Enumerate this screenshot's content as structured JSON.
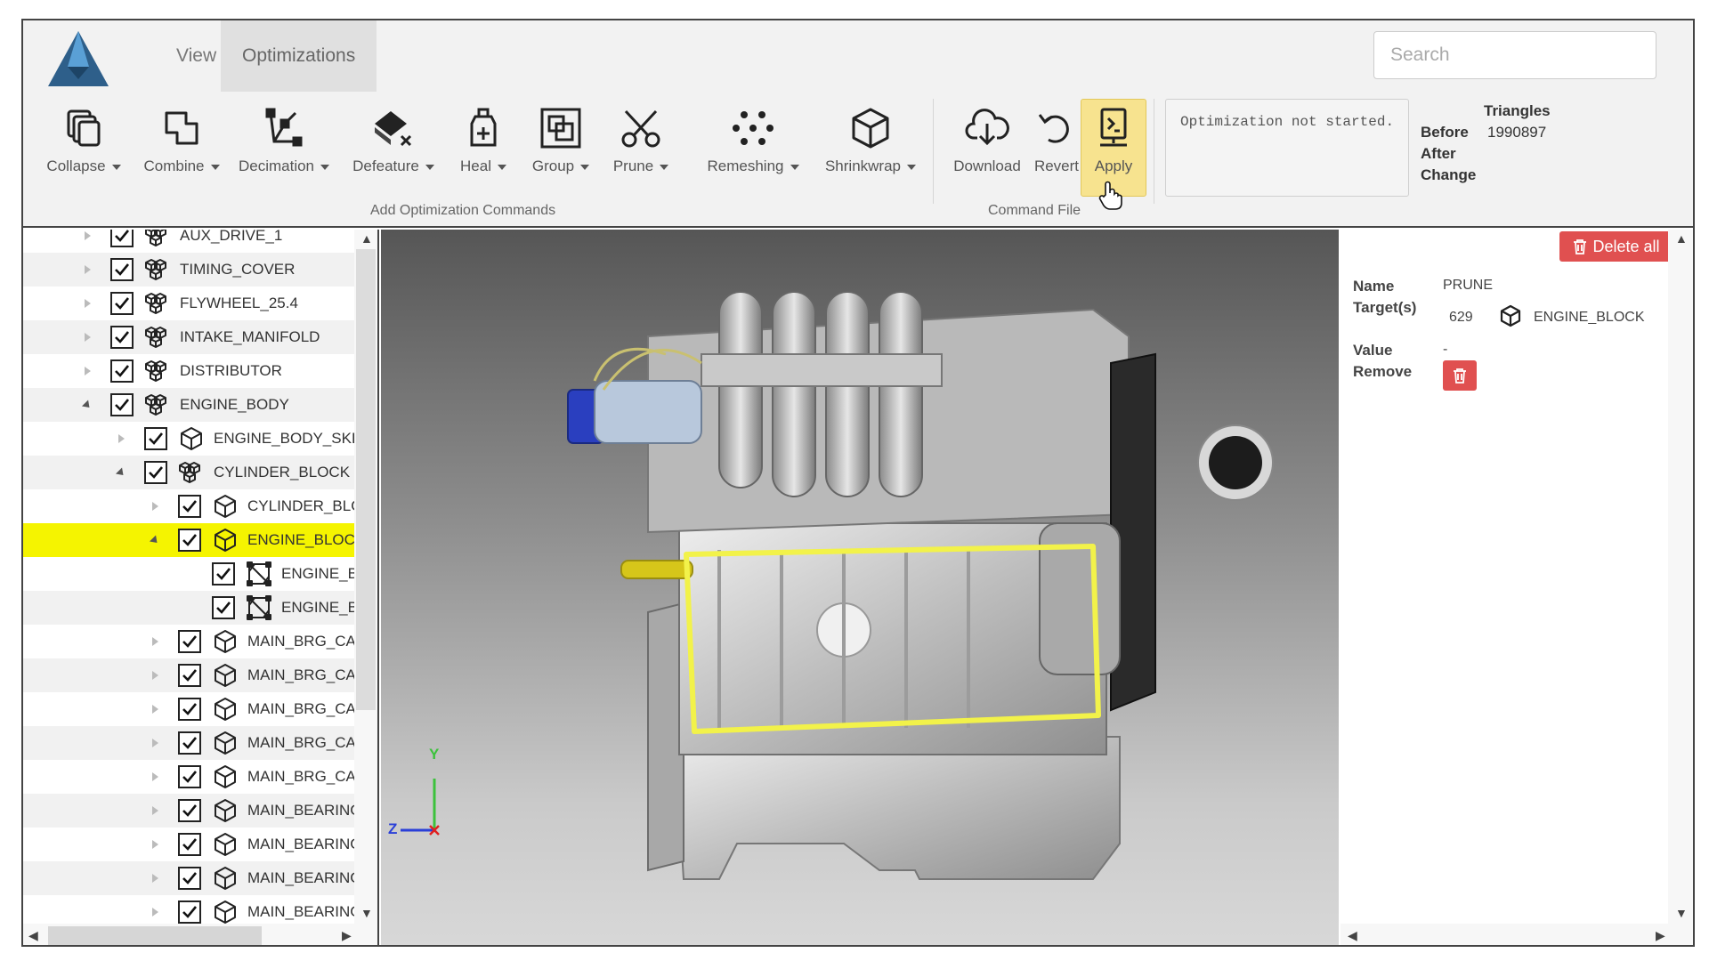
{
  "ribbon": {
    "tabs": [
      {
        "label": "View"
      },
      {
        "label": "Optimizations",
        "active": true
      }
    ],
    "search_placeholder": "Search",
    "tools": [
      {
        "label": "Collapse",
        "icon": "collapse-icon",
        "dropdown": true
      },
      {
        "label": "Combine",
        "icon": "combine-icon",
        "dropdown": true
      },
      {
        "label": "Decimation",
        "icon": "decimation-icon",
        "dropdown": true
      },
      {
        "label": "Defeature",
        "icon": "defeature-icon",
        "dropdown": true
      },
      {
        "label": "Heal",
        "icon": "heal-icon",
        "dropdown": true
      },
      {
        "label": "Group",
        "icon": "group-icon",
        "dropdown": true
      },
      {
        "label": "Prune",
        "icon": "scissors-icon",
        "dropdown": true
      },
      {
        "label": "Remeshing",
        "icon": "remeshing-icon",
        "dropdown": true
      },
      {
        "label": "Shrinkwrap",
        "icon": "shrinkwrap-icon",
        "dropdown": true
      }
    ],
    "add_group_label": "Add Optimization Commands",
    "file_tools": [
      {
        "label": "Download",
        "icon": "download-icon"
      },
      {
        "label": "Revert",
        "icon": "revert-icon"
      },
      {
        "label": "Apply",
        "icon": "apply-icon",
        "highlighted": true
      }
    ],
    "file_group_label": "Command File",
    "status": "Optimization not started.",
    "triangles": {
      "title": "Triangles",
      "before_label": "Before",
      "before_value": "1990897",
      "after_label": "After",
      "change_label": "Change"
    }
  },
  "tree": {
    "rows": [
      {
        "label": "AUX_DRIVE_1",
        "depth": 0,
        "expander": "collapsed",
        "icon": "assembly-icon"
      },
      {
        "label": "TIMING_COVER",
        "depth": 0,
        "expander": "collapsed",
        "icon": "assembly-icon"
      },
      {
        "label": "FLYWHEEL_25.4",
        "depth": 0,
        "expander": "collapsed",
        "icon": "assembly-icon"
      },
      {
        "label": "INTAKE_MANIFOLD",
        "depth": 0,
        "expander": "collapsed",
        "icon": "assembly-icon"
      },
      {
        "label": "DISTRIBUTOR",
        "depth": 0,
        "expander": "collapsed",
        "icon": "assembly-icon"
      },
      {
        "label": "ENGINE_BODY",
        "depth": 0,
        "expander": "expanded",
        "icon": "assembly-icon"
      },
      {
        "label": "ENGINE_BODY_SKEL",
        "depth": 1,
        "expander": "collapsed",
        "icon": "part-icon"
      },
      {
        "label": "CYLINDER_BLOCK",
        "depth": 1,
        "expander": "expanded",
        "icon": "assembly-icon"
      },
      {
        "label": "CYLINDER_BLOCI",
        "depth": 2,
        "expander": "collapsed",
        "icon": "part-icon"
      },
      {
        "label": "ENGINE_BLOCK",
        "depth": 2,
        "expander": "expanded",
        "icon": "part-icon",
        "selected": true
      },
      {
        "label": "ENGINE_BLO",
        "depth": 3,
        "expander": "none",
        "icon": "mesh-icon"
      },
      {
        "label": "ENGINE_BLO",
        "depth": 3,
        "expander": "none",
        "icon": "mesh-icon"
      },
      {
        "label": "MAIN_BRG_CAP_",
        "depth": 2,
        "expander": "collapsed",
        "icon": "part-icon"
      },
      {
        "label": "MAIN_BRG_CAP",
        "depth": 2,
        "expander": "collapsed",
        "icon": "part-icon"
      },
      {
        "label": "MAIN_BRG_CAP",
        "depth": 2,
        "expander": "collapsed",
        "icon": "part-icon"
      },
      {
        "label": "MAIN_BRG_CAP",
        "depth": 2,
        "expander": "collapsed",
        "icon": "part-icon"
      },
      {
        "label": "MAIN_BRG_CAP_",
        "depth": 2,
        "expander": "collapsed",
        "icon": "part-icon"
      },
      {
        "label": "MAIN_BEARING_E",
        "depth": 2,
        "expander": "collapsed",
        "icon": "part-icon"
      },
      {
        "label": "MAIN_BEARING_E",
        "depth": 2,
        "expander": "collapsed",
        "icon": "part-icon"
      },
      {
        "label": "MAIN_BEARING_I",
        "depth": 2,
        "expander": "collapsed",
        "icon": "part-icon"
      },
      {
        "label": "MAIN_BEARING_F",
        "depth": 2,
        "expander": "collapsed",
        "icon": "part-icon"
      }
    ]
  },
  "viewport": {
    "axis_labels": {
      "y": "Y",
      "z": "Z"
    }
  },
  "properties": {
    "delete_all_label": "Delete all",
    "name_label": "Name",
    "name_value": "PRUNE",
    "targets_label": "Target(s)",
    "target_count": "629",
    "target_name": "ENGINE_BLOCK",
    "value_label": "Value",
    "value_value": "-",
    "remove_label": "Remove"
  },
  "colors": {
    "accent_selected": "#f5f400",
    "apply_highlight": "#f7e38f",
    "danger": "#e05050",
    "logo": "#2e5f8a"
  }
}
